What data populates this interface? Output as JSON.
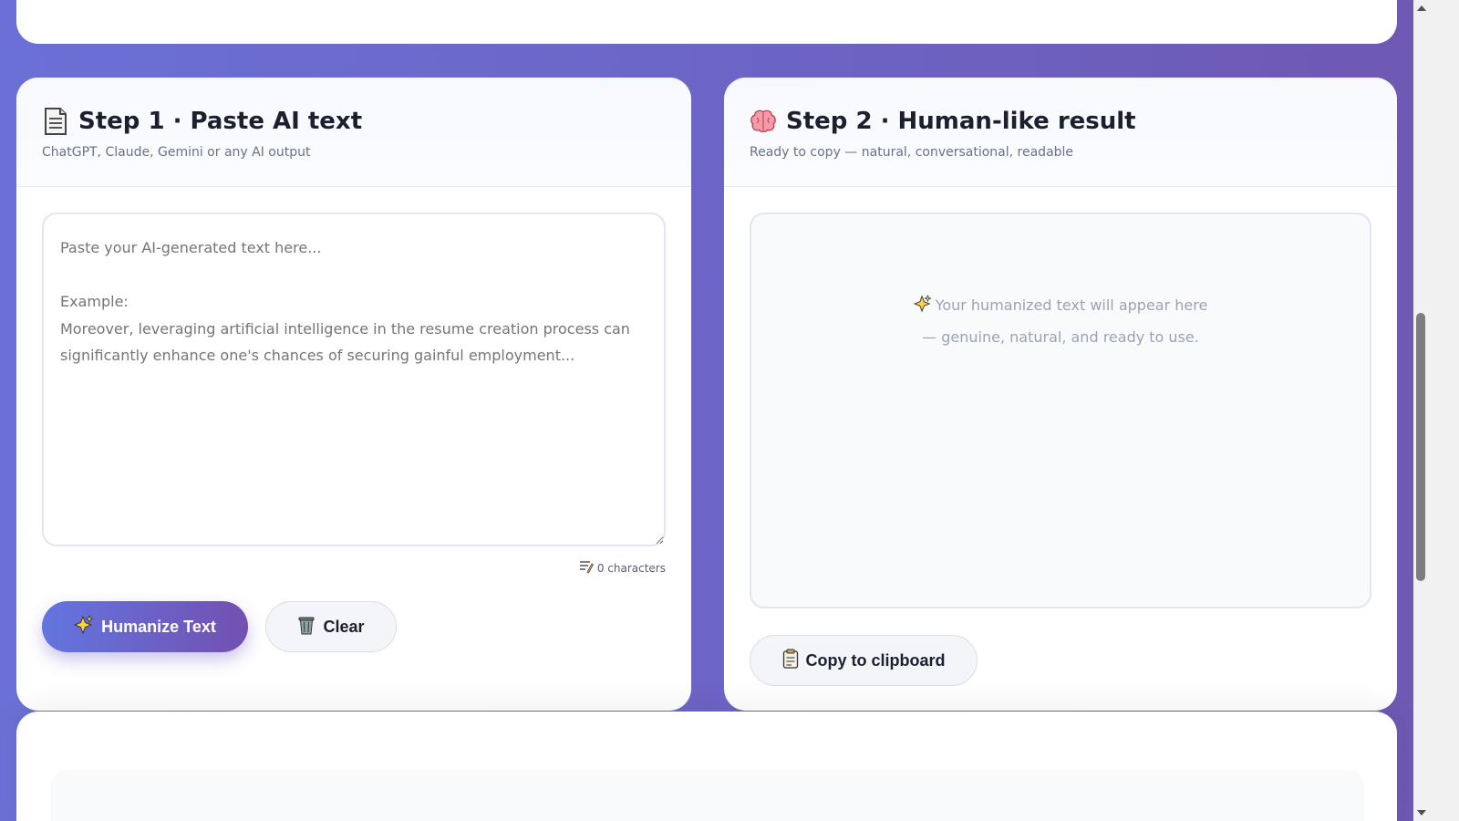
{
  "step1": {
    "title": "Step 1 · Paste AI text",
    "subtitle": "ChatGPT, Claude, Gemini or any AI output",
    "title_icon": "page-icon",
    "textarea": {
      "value": "",
      "placeholder": "Paste your AI-generated text here...\n\nExample:\nMoreover, leveraging artificial intelligence in the resume creation process can significantly enhance one's chances of securing gainful employment..."
    },
    "char_count": "0 characters",
    "char_count_icon": "text-lines-icon",
    "humanize_label": "Humanize Text",
    "humanize_icon": "sparkles-icon",
    "clear_label": "Clear",
    "clear_icon": "trash-icon"
  },
  "step2": {
    "title": "Step 2 · Human-like result",
    "subtitle": "Ready to copy — natural, conversational, readable",
    "title_icon": "brain-icon",
    "placeholder_line1": "Your humanized text will appear here",
    "placeholder_line2": "— genuine, natural, and ready to use.",
    "placeholder_icon": "sparkles-icon",
    "copy_label": "Copy to clipboard",
    "copy_icon": "clipboard-icon"
  },
  "colors": {
    "background_start": "#6b70d6",
    "background_end": "#6e58b2",
    "primary_button_start": "#6375e0",
    "primary_button_end": "#7350b0",
    "card": "#ffffff"
  }
}
